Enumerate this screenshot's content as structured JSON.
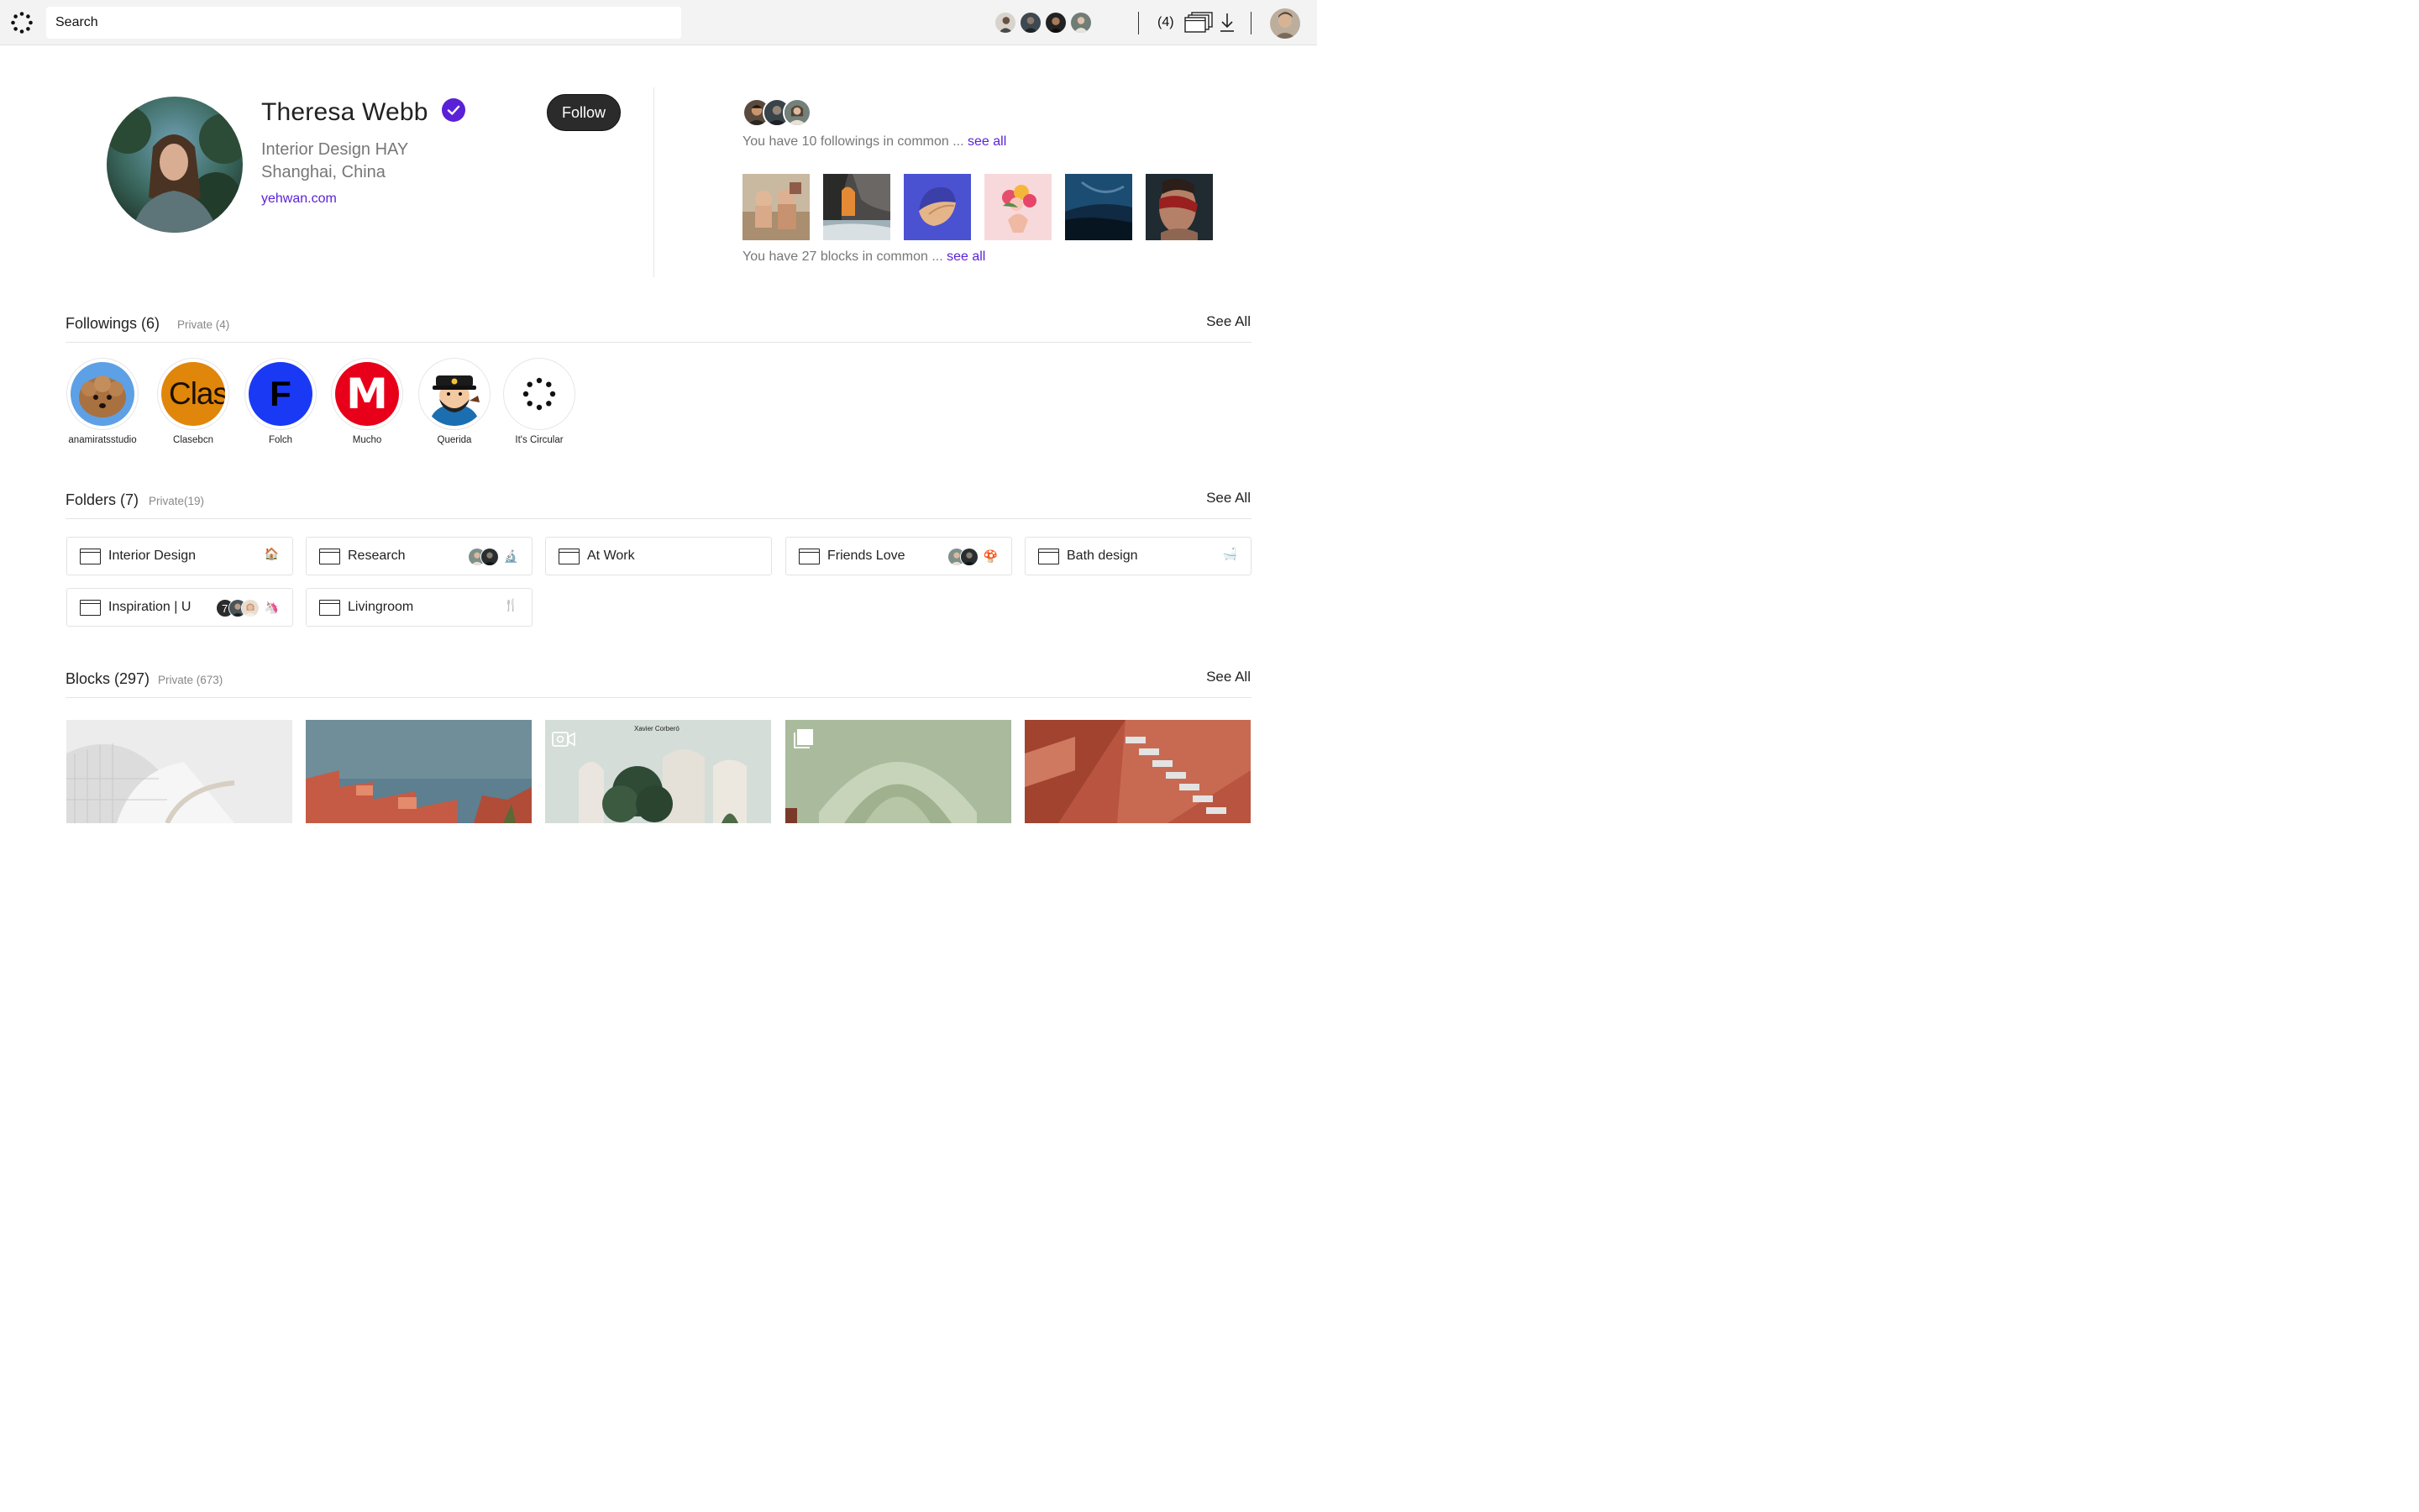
{
  "header": {
    "search_placeholder": "Search",
    "notifications_count": "(4)"
  },
  "profile": {
    "name": "Theresa Webb",
    "follow_label": "Follow",
    "company": "Interior Design HAY",
    "location": "Shanghai, China",
    "website": "yehwan.com",
    "common_followings_text": "You have 10 followings in common ...",
    "common_blocks_text": "You have 27 blocks in common ...",
    "see_all_link": "see all"
  },
  "followings": {
    "title": "Followings (6)",
    "private": "Private (4)",
    "see_all": "See All",
    "items": [
      {
        "label": "anamiratsstudio",
        "text": ""
      },
      {
        "label": "Clasebcn",
        "text": "Clas"
      },
      {
        "label": "Folch",
        "text": "F"
      },
      {
        "label": "Mucho",
        "text": "M"
      },
      {
        "label": "Querida",
        "text": ""
      },
      {
        "label": "It's Circular",
        "text": ""
      }
    ]
  },
  "folders": {
    "title": "Folders (7)",
    "private": "Private(19)",
    "see_all": "See All",
    "items": [
      {
        "label": "Interior Design",
        "emoji": "🏠"
      },
      {
        "label": "Research",
        "emoji": "🔬"
      },
      {
        "label": "At Work",
        "emoji": ""
      },
      {
        "label": "Friends Love",
        "emoji": "🍄"
      },
      {
        "label": "Bath design",
        "emoji": "🛁"
      },
      {
        "label": "Inspiration | U",
        "badge": "7",
        "emoji": "🦄"
      },
      {
        "label": "Livingroom",
        "emoji": "🍴"
      }
    ]
  },
  "blocks": {
    "title": "Blocks (297)",
    "private": "Private (673)",
    "see_all": "See All",
    "caption_3": "Xavier Corberó"
  },
  "colors": {
    "accent": "#5b21d6",
    "follow_button": "#2b2b2b",
    "topbar": "#f3f3f3"
  }
}
